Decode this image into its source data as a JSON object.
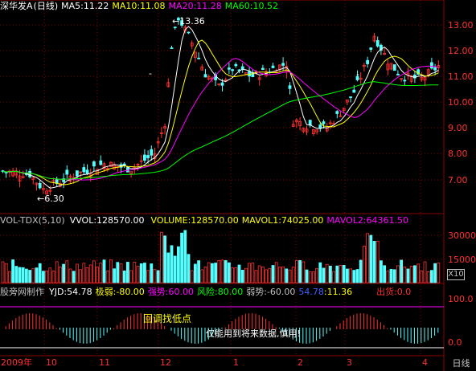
{
  "colors": {
    "bg": "#000000",
    "grid": "#8a0000",
    "up": "#ff3232",
    "down": "#54ffff",
    "ma5": "#ffffff",
    "ma10": "#ffff00",
    "ma20": "#ff00ff",
    "ma60": "#00ff00",
    "axis_text": "#ff3030"
  },
  "price_panel": {
    "stock_name": "深华发A",
    "period": "(日线)",
    "ma5": "MA5:11.22",
    "ma10": "MA10:11.08",
    "ma20": "MA20:11.28",
    "ma60": "MA60:10.52",
    "high_mark": "13.36",
    "low_mark": "6.30",
    "dash_left": "-",
    "dash_right": "-",
    "y_axis": [
      "13.00",
      "12.00",
      "11.00",
      "10.00",
      "9.00",
      "8.00",
      "7.00"
    ]
  },
  "volume_panel": {
    "indicator": "VOL-TDX(5,10)",
    "vvol": "VVOL:128570.00",
    "volume": "VOLUME:128570.00",
    "mavol1": "MAVOL1:74025.00",
    "mavol2": "MAVOL2:64361.50",
    "y_axis": [
      "30000",
      "15000"
    ],
    "unit_button": "X10"
  },
  "indicator_panel": {
    "name": "股旁网制作",
    "yjd": "YJD:54.78",
    "jiruo": "极弱:-80.00",
    "qiangshi": "强势:60.00",
    "fengxian": "风险:80.00",
    "ruoshi": "弱势:-60.00",
    "val1": "54.78",
    "val2": ":11.36",
    "chuhuo": "出货:0.0",
    "y_axis": [
      "100.0",
      "0.0"
    ],
    "annotation_1": "回调找低点",
    "annotation_2": "仅能用到将来数据,慎用!"
  },
  "x_axis": {
    "labels": [
      "2009年",
      "10",
      "11",
      "12",
      "1",
      "2",
      "3",
      "4"
    ],
    "period_button": "日线"
  }
}
